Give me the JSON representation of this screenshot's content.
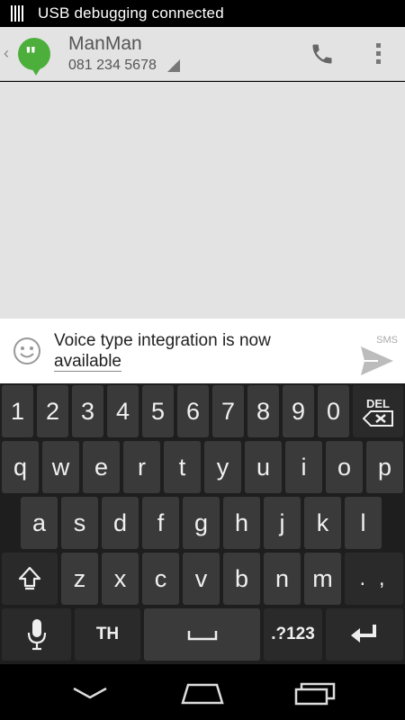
{
  "status_bar": {
    "text": "USB debugging connected",
    "icon": "usb-debug-icon"
  },
  "action_bar": {
    "back_icon": "chevron-left-icon",
    "app_icon": "hangouts-logo-icon",
    "contact_name": "ManMan",
    "contact_number": "081 234 5678",
    "call_icon": "phone-icon",
    "menu_icon": "overflow-menu-icon"
  },
  "compose": {
    "emoji_icon": "emoji-smiley-icon",
    "text_line1": "Voice type integration is now",
    "text_line2": "available",
    "send_label": "SMS",
    "send_icon": "send-icon"
  },
  "keyboard": {
    "row1": [
      "1",
      "2",
      "3",
      "4",
      "5",
      "6",
      "7",
      "8",
      "9",
      "0"
    ],
    "delete_label": "DEL",
    "row2": [
      "q",
      "w",
      "e",
      "r",
      "t",
      "y",
      "u",
      "i",
      "o",
      "p"
    ],
    "row3": [
      "a",
      "s",
      "d",
      "f",
      "g",
      "h",
      "j",
      "k",
      "l"
    ],
    "shift_icon": "shift-icon",
    "row4": [
      "z",
      "x",
      "c",
      "v",
      "b",
      "n",
      "m"
    ],
    "punct_label": ". ,",
    "mic_icon": "microphone-icon",
    "lang_label": "TH",
    "space_icon": "space-bar-icon",
    "symbols_label": ".?123",
    "enter_icon": "enter-icon"
  },
  "nav_bar": {
    "back_icon": "nav-back-icon",
    "home_icon": "nav-home-icon",
    "recents_icon": "nav-recents-icon"
  },
  "colors": {
    "hangouts_green": "#4caf3b",
    "action_bar_bg": "#e3e3e3",
    "key_bg": "#3a3a3a",
    "keyboard_bg": "#1e1e1e"
  }
}
